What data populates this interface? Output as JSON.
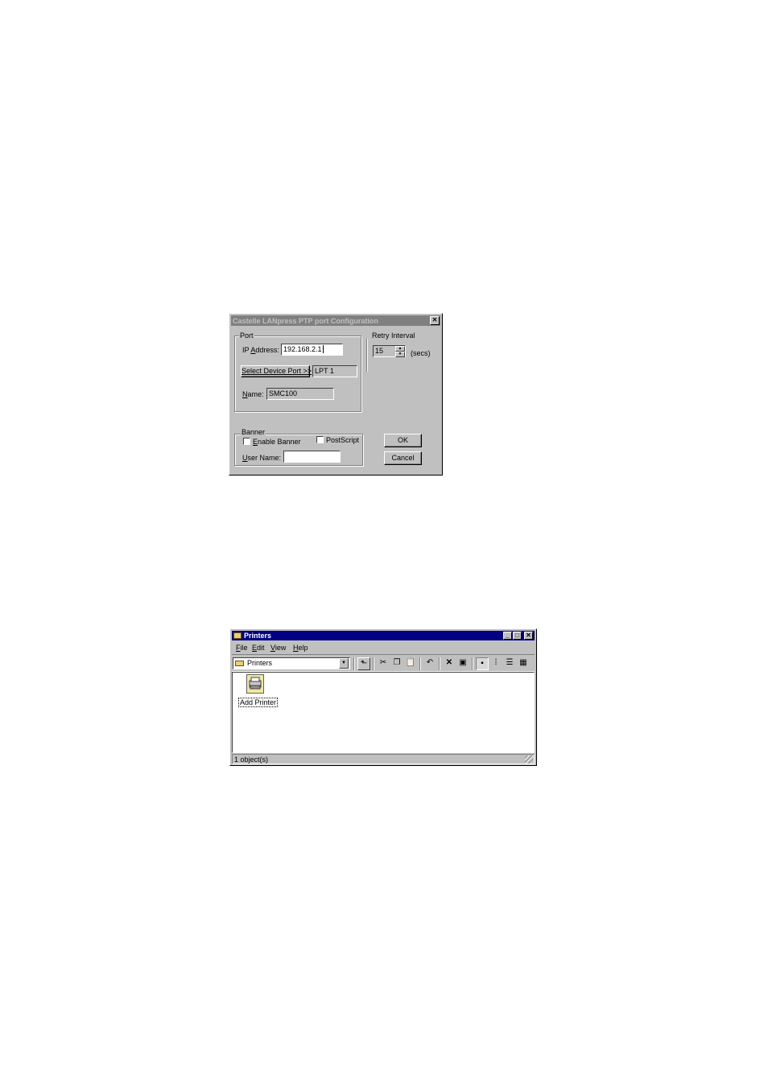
{
  "config_dialog": {
    "title": "Castelle LANpress PTP port  Configuration",
    "close_glyph": "✕",
    "port_group": {
      "label": "Port",
      "ip_label_pre": "IP ",
      "ip_label_accel": "A",
      "ip_label_post": "ddress:",
      "ip_value": "192.168.2.1",
      "select_port_button": "Select Device Port >>",
      "device_port_value": "LPT 1",
      "name_label_accel": "N",
      "name_label_post": "ame:",
      "name_value": "SMC100"
    },
    "retry_group": {
      "label": "Retry Interval",
      "value": "15",
      "unit": "(secs)"
    },
    "banner_group": {
      "label": "Banner",
      "enable_banner_accel": "E",
      "enable_banner_post": "nable Banner",
      "enable_banner_checked": false,
      "postscript_label": "PostScript",
      "postscript_checked": false,
      "user_name_accel": "U",
      "user_name_post": "ser Name:",
      "user_name_value": ""
    },
    "ok_button": "OK",
    "cancel_button": "Cancel"
  },
  "printers_window": {
    "title": "Printers",
    "caption_buttons": {
      "minimize": "_",
      "maximize": "□",
      "close": "✕"
    },
    "menu": [
      {
        "accel": "F",
        "rest": "ile"
      },
      {
        "accel": "E",
        "rest": "dit"
      },
      {
        "accel": "V",
        "rest": "iew"
      },
      {
        "accel": "H",
        "rest": "elp"
      }
    ],
    "address_combo_value": "Printers",
    "toolbar_icons": [
      "up-folder-icon",
      "cut-icon",
      "copy-icon",
      "paste-icon",
      "undo-icon",
      "delete-icon",
      "properties-icon",
      "large-icons-icon",
      "small-icons-icon",
      "list-icon",
      "details-icon"
    ],
    "items": [
      {
        "label": "Add Printer",
        "icon": "add-printer-icon"
      }
    ],
    "status_text": "1 object(s)"
  }
}
